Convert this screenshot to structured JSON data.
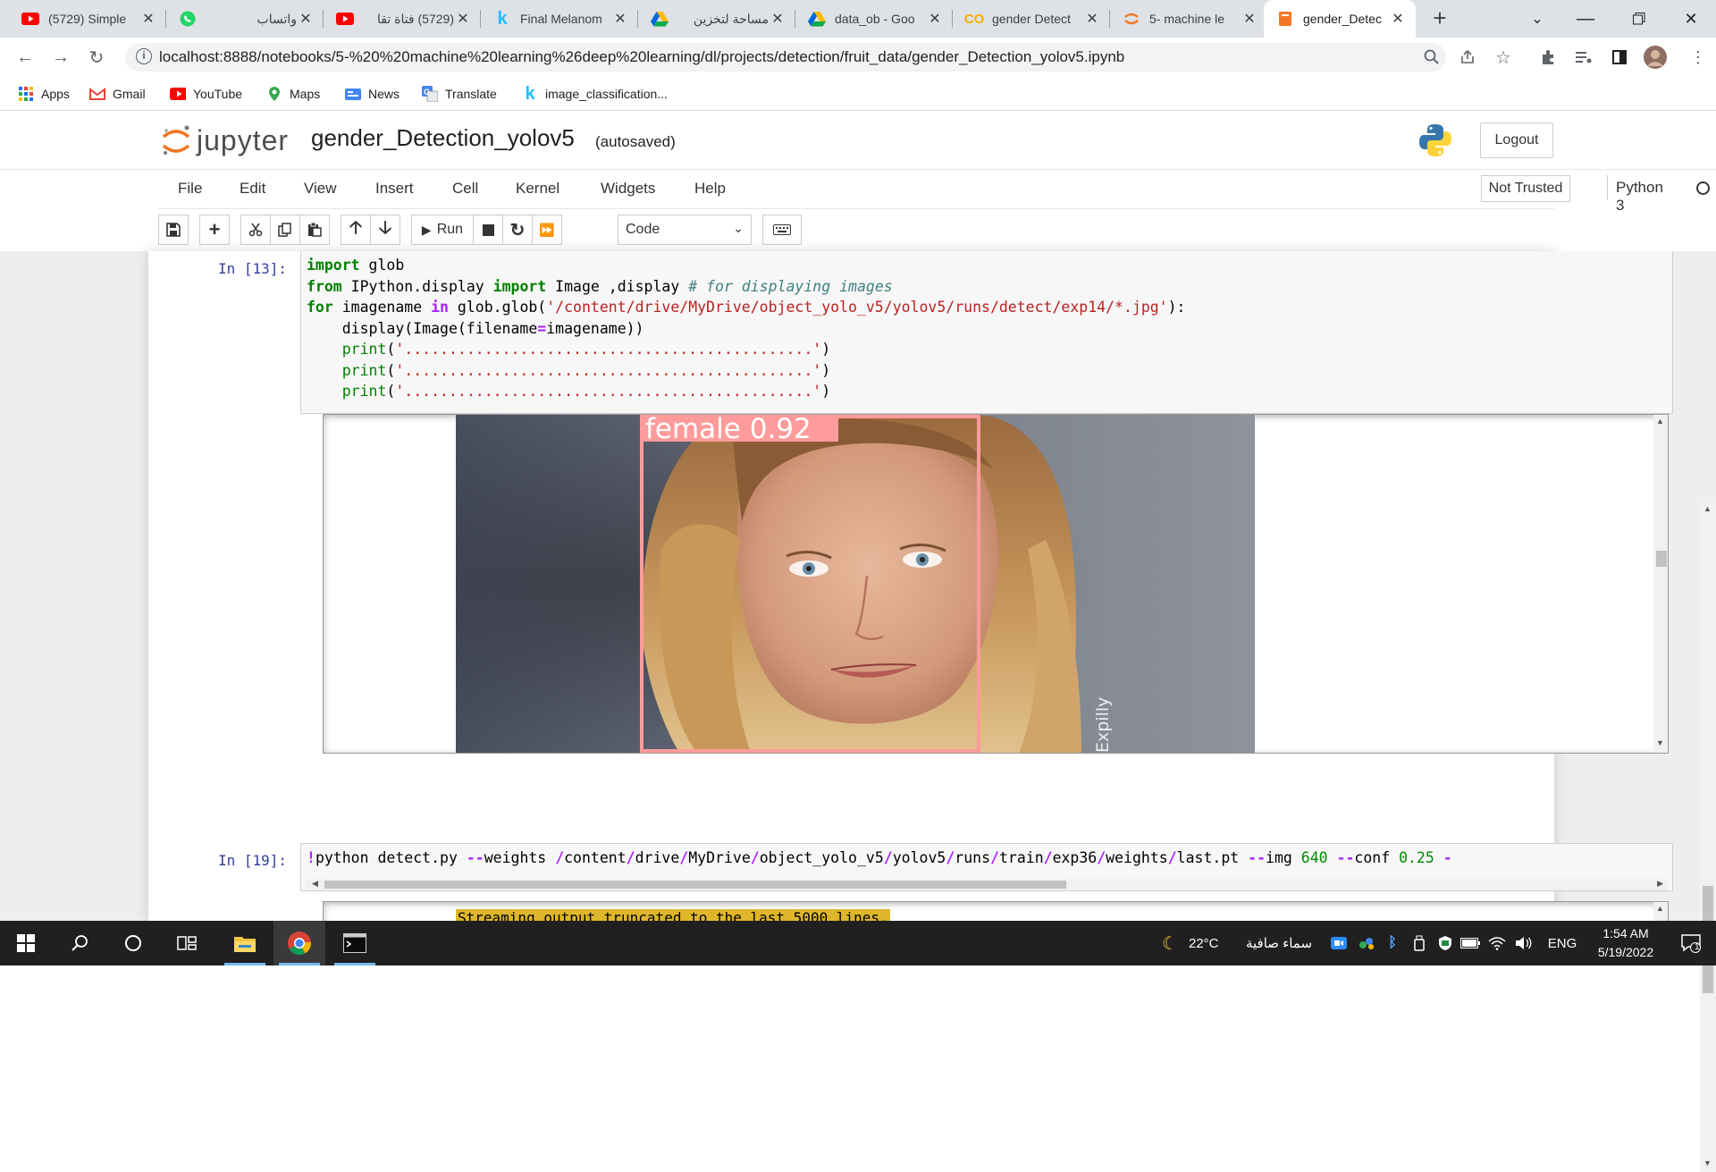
{
  "browser": {
    "tabs": [
      {
        "title": "(5729) Simple",
        "icon": "youtube-icon"
      },
      {
        "title": "واتساب",
        "icon": "whatsapp-icon"
      },
      {
        "title": "(5729) فتاة تقا",
        "icon": "youtube-icon"
      },
      {
        "title": "Final Melanom",
        "icon": "kaggle-icon"
      },
      {
        "title": "مساحة لتخزين",
        "icon": "google-drive-icon"
      },
      {
        "title": "data_ob - Goo",
        "icon": "google-drive-icon"
      },
      {
        "title": "gender Detect",
        "icon": "colab-icon"
      },
      {
        "title": "5- machine le",
        "icon": "jupyter-icon"
      },
      {
        "title": "gender_Detec",
        "icon": "notebook-icon",
        "active": true
      }
    ],
    "url": "localhost:8888/notebooks/5-%20%20machine%20learning%26deep%20learning/dl/projects/detection/fruit_data/gender_Detection_yolov5.ipynb",
    "bookmarks": [
      {
        "label": "Apps",
        "icon": "apps-grid-icon"
      },
      {
        "label": "Gmail",
        "icon": "gmail-icon"
      },
      {
        "label": "YouTube",
        "icon": "youtube-icon"
      },
      {
        "label": "Maps",
        "icon": "maps-icon"
      },
      {
        "label": "News",
        "icon": "news-icon"
      },
      {
        "label": "Translate",
        "icon": "translate-icon"
      },
      {
        "label": "image_classification...",
        "icon": "kaggle-icon"
      }
    ]
  },
  "jupyter": {
    "logo_text": "jupyter",
    "notebook_name": "gender_Detection_yolov5",
    "autosave": "(autosaved)",
    "logout": "Logout",
    "menu": [
      "File",
      "Edit",
      "View",
      "Insert",
      "Cell",
      "Kernel",
      "Widgets",
      "Help"
    ],
    "trust": "Not Trusted",
    "kernel": "Python 3",
    "run_label": "Run",
    "cell_type": "Code"
  },
  "cells": [
    {
      "prompt": "In [13]:",
      "output_label": "female 0.92",
      "output_watermark": "Expilly"
    },
    {
      "prompt": "In [19]:",
      "stream_notice": "Streaming output truncated to the last 5000 lines."
    }
  ],
  "taskbar": {
    "weather_temp": "22°C",
    "weather_desc": "سماء صافية",
    "lang": "ENG",
    "time": "1:54 AM",
    "date": "5/19/2022",
    "notifications": "1"
  }
}
